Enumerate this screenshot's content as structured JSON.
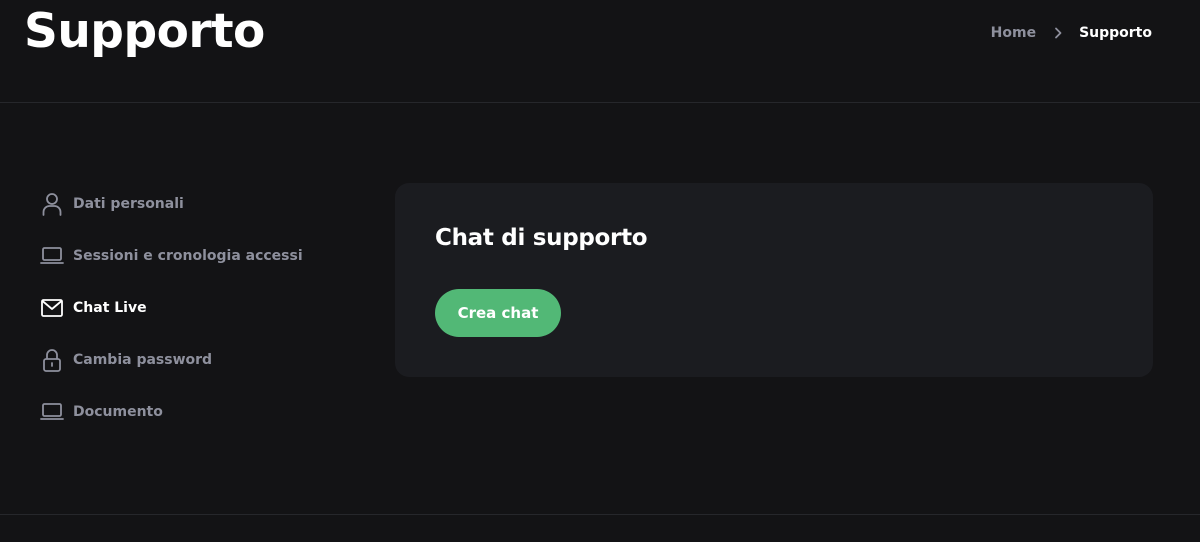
{
  "header": {
    "title": "Supporto",
    "breadcrumb": {
      "home": "Home",
      "current": "Supporto"
    }
  },
  "sidebar": {
    "items": [
      {
        "label": "Dati personali",
        "icon": "user-icon",
        "active": false
      },
      {
        "label": "Sessioni e cronologia accessi",
        "icon": "laptop-icon",
        "active": false
      },
      {
        "label": "Chat Live",
        "icon": "mail-icon",
        "active": true
      },
      {
        "label": "Cambia password",
        "icon": "lock-icon",
        "active": false
      },
      {
        "label": "Documento",
        "icon": "laptop-icon",
        "active": false
      }
    ]
  },
  "main": {
    "card_title": "Chat di supporto",
    "create_chat_label": "Crea chat"
  },
  "colors": {
    "background": "#131315",
    "card": "#1b1c20",
    "accent": "#52b876",
    "muted_text": "#8e909d"
  }
}
